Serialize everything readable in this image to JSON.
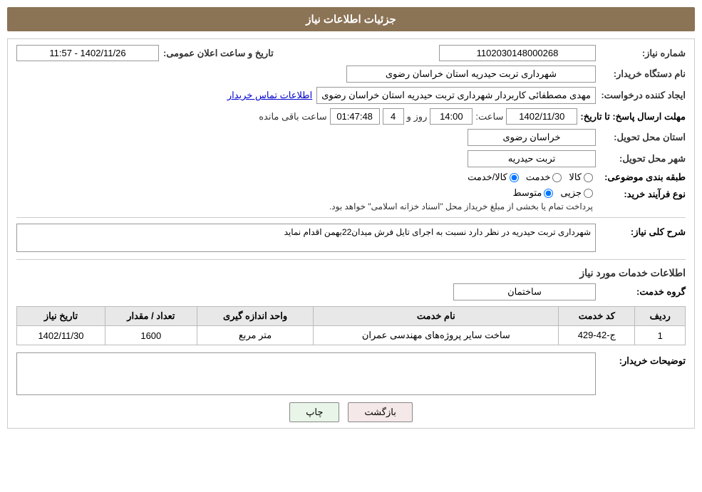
{
  "page": {
    "title": "جزئیات اطلاعات نیاز"
  },
  "header": {
    "title": "جزئیات اطلاعات نیاز"
  },
  "fields": {
    "shem_label": "شماره نیاز:",
    "shem_value": "1102030148000268",
    "org_label": "نام دستگاه خریدار:",
    "org_value": "شهرداری تربت حیدریه استان خراسان رضوی",
    "creator_label": "ایجاد کننده درخواست:",
    "creator_value": "مهدی مصطفائی کاربردار شهرداری تربت حیدریه استان خراسان رضوی",
    "contact_link": "اطلاعات تماس خریدار",
    "deadline_label": "مهلت ارسال پاسخ: تا تاریخ:",
    "deadline_date": "1402/11/30",
    "deadline_time_label": "ساعت:",
    "deadline_time": "14:00",
    "deadline_days_label": "روز و",
    "deadline_days": "4",
    "deadline_remaining_label": "ساعت باقی مانده",
    "deadline_remaining": "01:47:48",
    "province_label": "استان محل تحویل:",
    "province_value": "خراسان رضوی",
    "city_label": "شهر محل تحویل:",
    "city_value": "تربت حیدریه",
    "category_label": "طبقه بندی موضوعی:",
    "category_kala": "کالا",
    "category_khadamat": "خدمت",
    "category_kala_khadamat": "کالا/خدمت",
    "proc_label": "نوع فرآیند خرید:",
    "proc_jazyi": "جزیی",
    "proc_motavaset": "متوسط",
    "proc_note": "پرداخت تمام یا بخشی از مبلغ خریداز محل \"اسناد خزانه اسلامی\" خواهد بود.",
    "sharh_label": "شرح کلی نیاز:",
    "sharh_value": "شهرداری تربت حیدریه در نظر دارد نسبت به اجرای تایل فرش میدان22بهمن اقدام نماید",
    "services_title": "اطلاعات خدمات مورد نیاز",
    "group_label": "گروه خدمت:",
    "group_value": "ساختمان",
    "table_headers": [
      "ردیف",
      "کد خدمت",
      "نام خدمت",
      "واحد اندازه گیری",
      "تعداد / مقدار",
      "تاریخ نیاز"
    ],
    "table_rows": [
      {
        "row": "1",
        "code": "ج-42-429",
        "name": "ساخت سایر پروژه‌های مهندسی عمران",
        "unit": "متر مربع",
        "qty": "1600",
        "date": "1402/11/30"
      }
    ],
    "tawzihat_label": "توضیحات خریدار:",
    "announce_label": "تاریخ و ساعت اعلان عمومی:",
    "announce_value": "1402/11/26 - 11:57"
  },
  "buttons": {
    "back_label": "بازگشت",
    "print_label": "چاپ"
  }
}
